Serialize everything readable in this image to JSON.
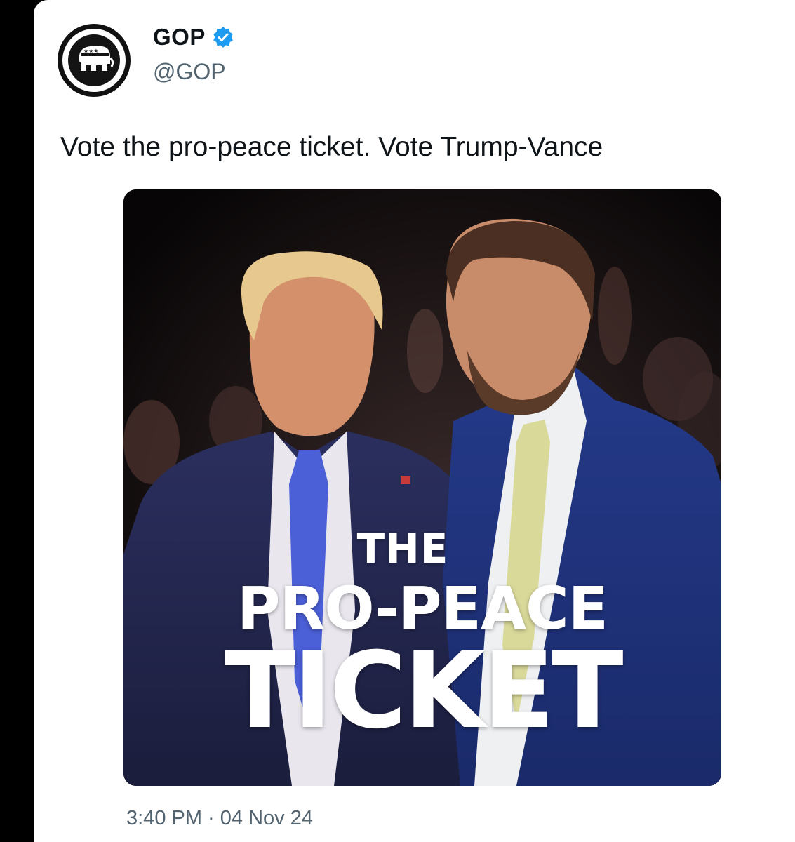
{
  "post": {
    "author_name": "GOP",
    "author_handle": "@GOP",
    "verified": true,
    "verified_color": "#1d9bf0",
    "text": "Vote the pro-peace ticket. Vote Trump-Vance",
    "timestamp": "3:40 PM · 04 Nov 24"
  },
  "media": {
    "headline_line1": "THE",
    "headline_line2": "PRO-PEACE",
    "headline_line3": "TICKET",
    "gradient_colors": [
      "#b81d24",
      "#3b2f8a",
      "#1f3ea8"
    ]
  },
  "icons": {
    "avatar": "republican-elephant-logo-icon",
    "verified": "verified-badge-icon"
  }
}
